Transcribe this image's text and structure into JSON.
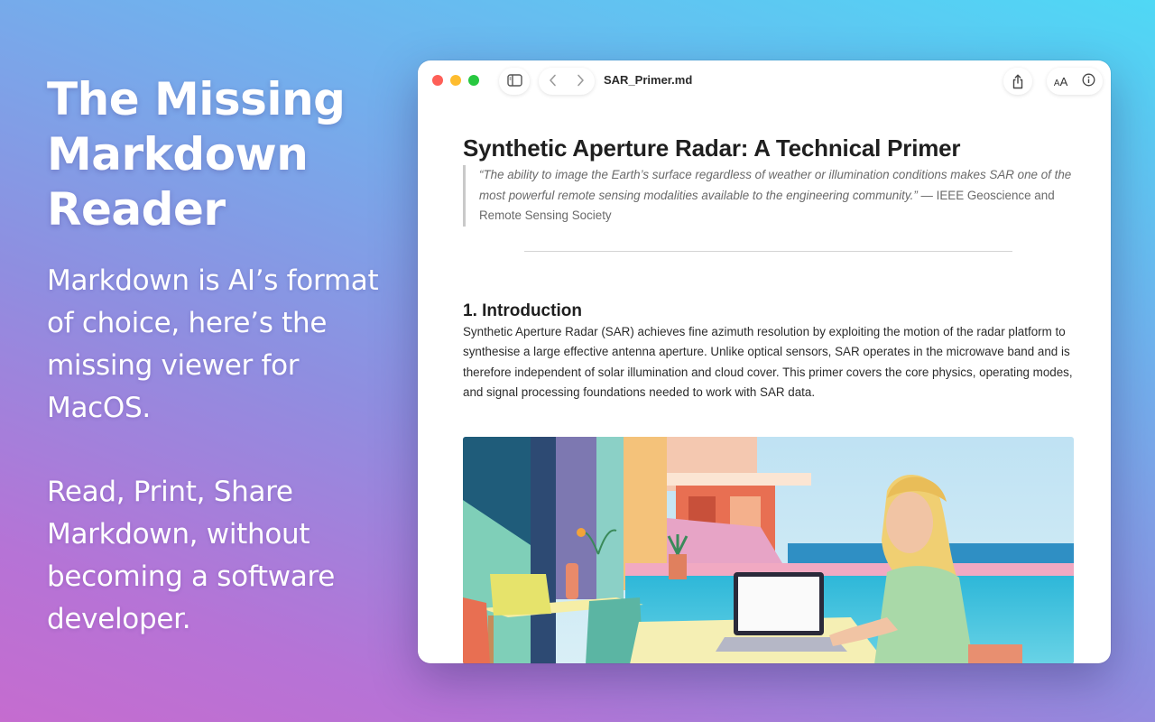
{
  "hero": {
    "title": "The Missing\nMarkdown\nReader",
    "paragraph1": "Markdown is AI’s format of choice, here’s the missing viewer for MacOS.",
    "paragraph2": "Read, Print, Share Markdown, without becoming a software developer."
  },
  "window": {
    "file_name": "SAR_Primer.md",
    "toolbar": {
      "sidebar_icon": "sidebar-icon",
      "back_icon": "chevron-left-icon",
      "forward_icon": "chevron-right-icon",
      "share_icon": "share-icon",
      "text_size_label": "AA",
      "info_icon": "info-icon"
    }
  },
  "document": {
    "title": "Synthetic Aperture Radar: A Technical Primer",
    "quote_text": "“The ability to image the Earth’s surface regardless of weather or illumination conditions makes SAR one of the most powerful remote sensing modalities available to the engineering community.”",
    "quote_attribution": "— IEEE Geoscience and Remote Sensing Society",
    "section1_heading": "1. Introduction",
    "section1_body": "Synthetic Aperture Radar (SAR) achieves fine azimuth resolution by exploiting the motion of the radar platform to synthesise a large effective antenna aperture. Unlike optical sensors, SAR operates in the microwave band and is therefore independent of solar illumination and cloud cover. This primer covers the core physics, operating modes, and signal processing foundations needed to work with SAR data."
  },
  "colors": {
    "traffic_red": "#fe5f57",
    "traffic_yellow": "#febc2e",
    "traffic_green": "#28c840"
  }
}
